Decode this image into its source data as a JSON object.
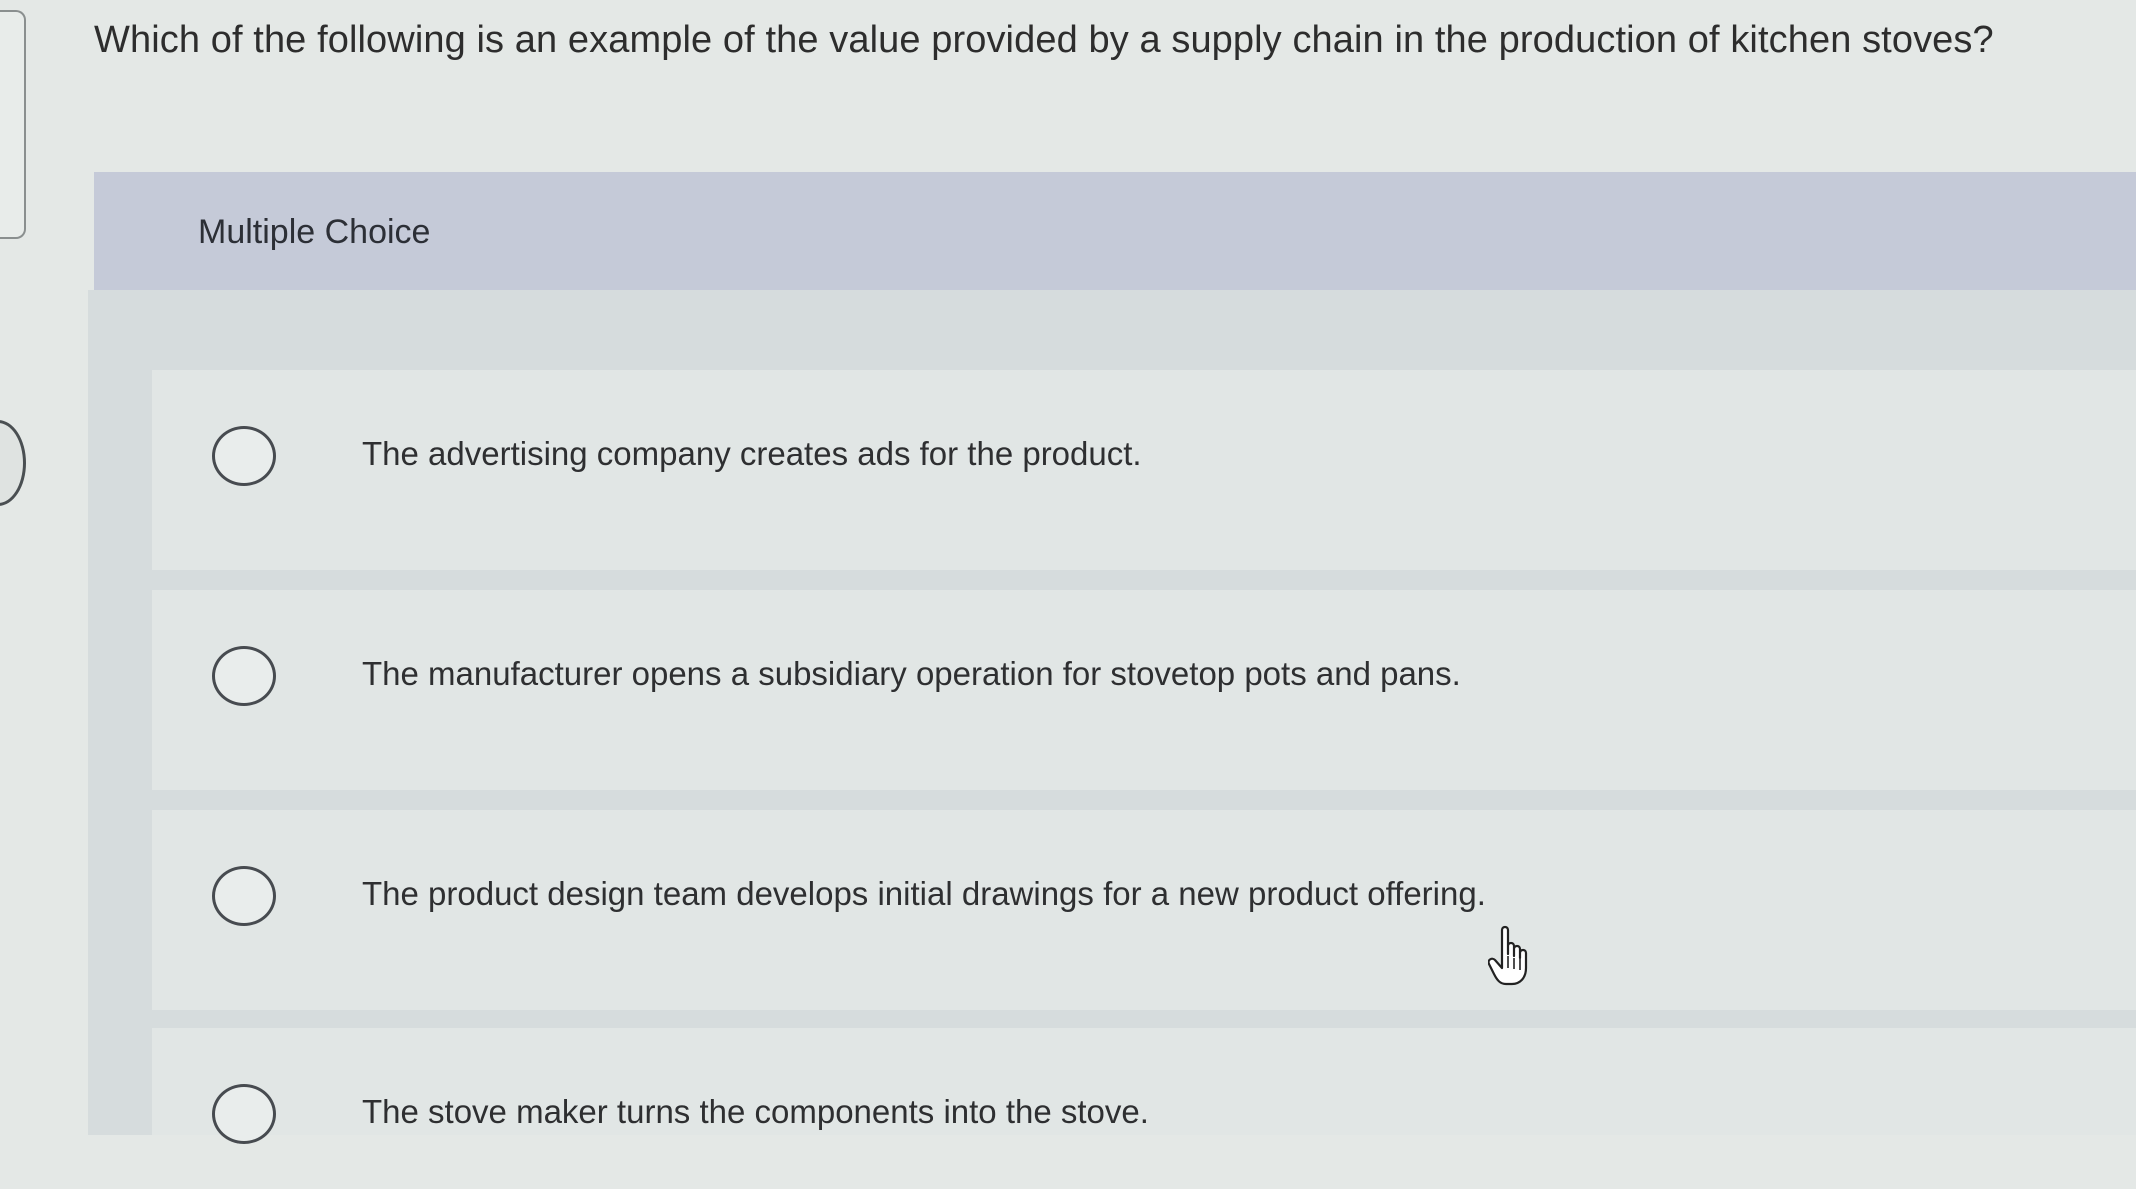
{
  "question": {
    "text": "Which of the following is an example of the value provided by a supply chain in the production of kitchen stoves?"
  },
  "multiple_choice": {
    "label": "Multiple Choice",
    "options": [
      {
        "text": "The advertising company creates ads for the product."
      },
      {
        "text": "The manufacturer opens a subsidiary operation for stovetop pots and pans."
      },
      {
        "text": "The product design team develops initial drawings for a new product offering."
      },
      {
        "text": "The stove maker turns the components into the stove."
      }
    ]
  },
  "icons": {
    "radio": "radio-unselected-icon",
    "cursor": "hand-pointer-icon"
  },
  "colors": {
    "header_band": "#c5cad8",
    "choice_row": "#e1e6e5",
    "page_background": "#e4e8e6",
    "text": "#2d2d2d"
  }
}
